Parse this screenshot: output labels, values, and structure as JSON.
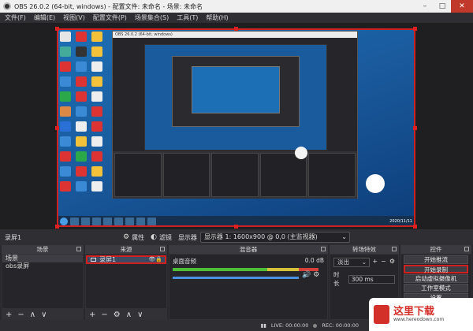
{
  "window": {
    "title": "OBS 26.0.2 (64-bit, windows) - 配置文件: 未命名 - 场景: 未命名",
    "min": "–",
    "max": "□",
    "close": "✕"
  },
  "menu": [
    "文件(F)",
    "编辑(E)",
    "视图(V)",
    "配置文件(P)",
    "场景集合(S)",
    "工具(T)",
    "帮助(H)"
  ],
  "preview": {
    "nested_title": "OBS 26.0.2 (64-bit, windows)",
    "clock": "2020/11/11"
  },
  "toolbar": {
    "source_name": "录屏1",
    "properties": "属性",
    "filters": "滤镜",
    "display_label": "显示器",
    "display_value": "显示器 1: 1600x900 @ 0,0 (主监视器)"
  },
  "docks": {
    "scenes": {
      "title": "场景",
      "items": [
        "场景",
        "obs录屏"
      ]
    },
    "sources": {
      "title": "来源",
      "items": [
        "录屏1"
      ]
    },
    "mixer": {
      "title": "混音器",
      "track": "桌面音频",
      "level": "0.0 dB",
      "volume_fraction": 1.0
    },
    "transitions": {
      "title": "转场特效",
      "type": "淡出",
      "duration_label": "时长",
      "duration": "300 ms"
    },
    "controls": {
      "title": "控件",
      "buttons": [
        "开始推流",
        "开始录制",
        "启动虚拟摄像机",
        "工作室模式",
        "设置"
      ]
    }
  },
  "status": {
    "live": "LIVE: 00:00:00",
    "rec": "REC: 00:00:00"
  },
  "watermark": {
    "text": "这里下载",
    "url": "www.hereodown.com"
  }
}
